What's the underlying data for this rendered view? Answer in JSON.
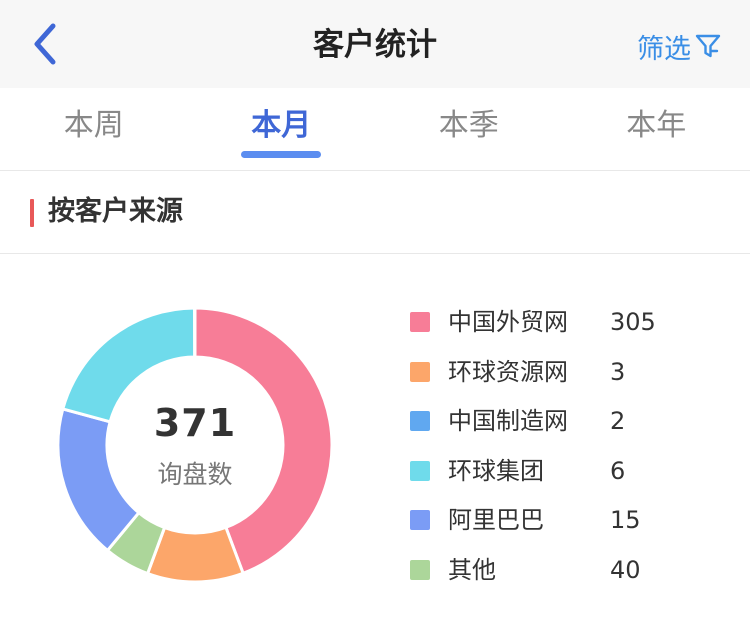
{
  "header": {
    "title": "客户统计",
    "filter_label": "筛选",
    "back_icon": "chevron-left-icon",
    "filter_icon": "funnel-icon",
    "accent_color": "#3a8ee6"
  },
  "tabs": [
    {
      "label": "本周",
      "active": false
    },
    {
      "label": "本月",
      "active": true
    },
    {
      "label": "本季",
      "active": false
    },
    {
      "label": "本年",
      "active": false
    }
  ],
  "section": {
    "title": "按客户来源",
    "accent_color": "#e85858"
  },
  "chart_data": {
    "type": "pie",
    "center_value": "371",
    "center_label": "询盘数",
    "categories": [
      "中国外贸网",
      "环球资源网",
      "中国制造网",
      "环球集团",
      "阿里巴巴",
      "其他"
    ],
    "values": [
      "305",
      "3",
      "2",
      "6",
      "15",
      "40"
    ],
    "colors": [
      "#f77d97",
      "#fca66a",
      "#60a8f0",
      "#6fdbeb",
      "#7b9cf5",
      "#acd69a"
    ],
    "slice_fractions": [
      0.3557,
      0.091,
      0.0004,
      0.1663,
      0.1463,
      0.0434
    ],
    "legend_position": "right"
  }
}
